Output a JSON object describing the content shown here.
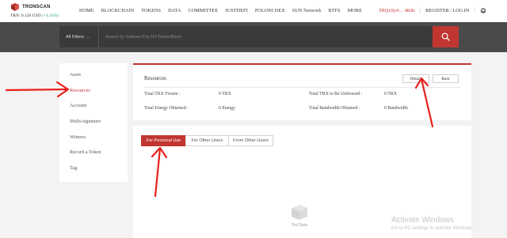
{
  "brand": {
    "name": "TRONSCAN"
  },
  "ticker": {
    "text": "TRX: 0.126 USD",
    "change": "(+4.34%)"
  },
  "nav": [
    "HOME",
    "BLOCKCHAIN",
    "TOKENS",
    "DATA",
    "COMMITTEE",
    "JUSTDEFI",
    "POLONI DEX",
    "SUN Network",
    "BTFS",
    "MORE"
  ],
  "account": {
    "address": "TRQxSy4… 4K8s",
    "auth": "REGISTER / LOG IN"
  },
  "search": {
    "filter_label": "All Filters",
    "placeholder": "Search by Address/Txn ID/Token/Block"
  },
  "sidebar": {
    "items": [
      {
        "label": "Asset"
      },
      {
        "label": "Resources"
      },
      {
        "label": "Account"
      },
      {
        "label": "Multi-signature"
      },
      {
        "label": "Witness"
      },
      {
        "label": "Record a Token"
      },
      {
        "label": "Tag"
      }
    ]
  },
  "resources": {
    "title": "Resources",
    "obtain_label": "Obtain",
    "rent_label": "Rent",
    "stats": [
      {
        "label": "Total TRX Frozen :",
        "value": "0 TRX"
      },
      {
        "label": "Total TRX to Be Unfreezed :",
        "value": "0 TRX"
      },
      {
        "label": "Total Energy Obtained :",
        "value": "0 Energy"
      },
      {
        "label": "Total Bandwidth Obtained :",
        "value": "0 Bandwidth"
      }
    ]
  },
  "tabs": [
    "For Personal Use",
    "For Other Users",
    "From Other Users"
  ],
  "empty": {
    "text": "No Data"
  },
  "watermark": {
    "title": "Activate Windows",
    "subtitle": "Go to PC settings to activate Windows."
  },
  "colors": {
    "accent": "#c23631",
    "band": "#4a4a4a",
    "positive": "#2aa760"
  },
  "icons": [
    "tronscan-logo-icon",
    "graduation-cap-icon",
    "chevron-down-icon",
    "search-icon",
    "empty-box-icon",
    "annotation-arrow"
  ]
}
